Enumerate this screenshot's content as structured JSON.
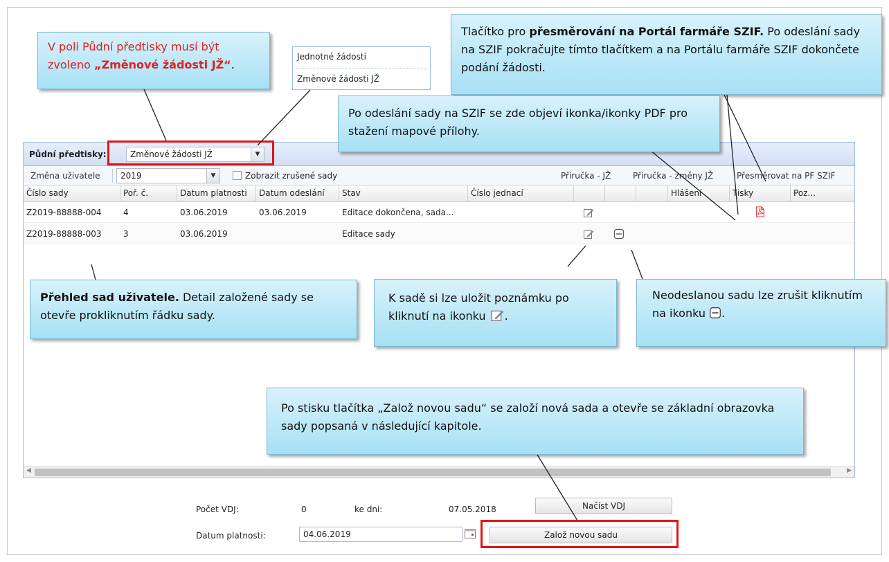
{
  "callouts": {
    "select_note_prefix": "V poli Půdní předtisky musí být zvoleno ",
    "select_note_bold": "„Změnové žádosti JŽ“",
    "select_note_suffix": ".",
    "portal_pre": "Tlačítko pro ",
    "portal_bold": "přesměrování na Portál farmáře SZIF.",
    "portal_post": " Po odeslání sady na SZIF pokračujte tímto tlačítkem a na Portálu farmáře SZIF dokončete podání žádosti.",
    "pdf_note": "Po odeslání sady na SZIF se zde objeví ikonka/ikonky PDF pro stažení mapové přílohy.",
    "overview_bold": "Přehled sad uživatele.",
    "overview_rest": " Detail založené sady se otevře prokliknutím řádku sady.",
    "note_text": "K sadě si lze uložit poznámku po kliknutí na ikonku",
    "cancel_text": "Neodeslanou sadu lze zrušit kliknutím na ikonku",
    "period": ".",
    "new_set_text": "Po stisku tlačítka „Založ novou sadu“ se založí nová sada a otevře se základní obrazovka sady popsaná v následující kapitole."
  },
  "dropdown_popup": {
    "options": [
      "Jednotné žádosti",
      "Změnové žádosti JŽ"
    ]
  },
  "toolbar": {
    "pudni_label": "Půdní předtisky:",
    "pudni_value": "Změnové žádosti JŽ",
    "user_change": "Změna uživatele",
    "year_value": "2019",
    "show_cancelled": "Zobrazit zrušené sady",
    "link_guide": "Příručka - JŽ",
    "link_guide_changes": "Příručka - změny JŽ",
    "link_redirect": "Přesměrovat na PF SZIF"
  },
  "grid": {
    "columns": [
      "Číslo sady",
      "Poř. č.",
      "Datum platnosti",
      "Datum odeslání",
      "Stav",
      "Číslo jednací",
      "",
      "",
      "",
      "Hlášení",
      "Tisky",
      "Poz..."
    ],
    "rows": [
      {
        "id": "Z2019-88888-004",
        "order": "4",
        "valid": "03.06.2019",
        "sent": "03.06.2019",
        "state": "Editace dokončena, sada..."
      },
      {
        "id": "Z2019-88888-003",
        "order": "3",
        "valid": "03.06.2019",
        "sent": "",
        "state": "Editace sady"
      }
    ]
  },
  "footer": {
    "vdj_count_label": "Počet VDJ:",
    "vdj_count_value": "0",
    "as_of_label": "ke dni:",
    "as_of_value": "07.05.2018",
    "load_vdj_button": "Načíst VDJ",
    "valid_date_label": "Datum platnosti:",
    "valid_date_value": "04.06.2019",
    "new_set_button": "Založ novou sadu"
  },
  "colors": {
    "highlight_red": "#e01515",
    "callout_blue": "#a6e0f5",
    "panel_border": "#99bbe8",
    "pdf_red": "#e03030"
  }
}
